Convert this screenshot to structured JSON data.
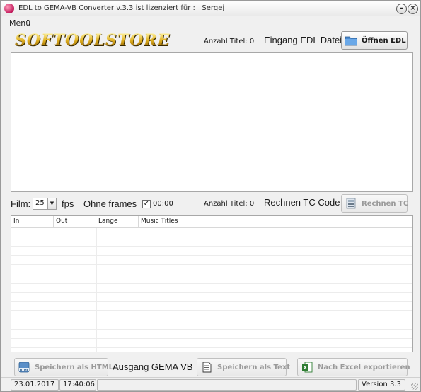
{
  "window": {
    "title": "EDL to GEMA-VB Converter v.3.3 ist lizenziert für :   Sergej",
    "minimize_glyph": "–",
    "close_glyph": "×"
  },
  "menu": {
    "label": "Menü"
  },
  "logo": {
    "text": "SOFTOOLSTORE"
  },
  "top_bar": {
    "count_label": "Anzahl Titel: 0",
    "input_label": "Eingang EDL Datei",
    "open_button": "Öffnen EDL",
    "open_icon": "folder-icon"
  },
  "mid_bar": {
    "film_label": "Film:",
    "fps_value": "25",
    "fps_label": "fps",
    "frames_label": "Ohne frames",
    "checkbox_mark": "✓",
    "checkbox_label": "00:00",
    "count_label": "Anzahl Titel: 0",
    "calc_label": "Rechnen TC Code",
    "calc_button": "Rechnen TC",
    "calc_icon": "calculator-icon"
  },
  "grid": {
    "columns": [
      "In",
      "Out",
      "Länge",
      "Music Titles"
    ]
  },
  "bottom_bar": {
    "html_button": "Speichern als HTML",
    "html_icon": "html-file-icon",
    "output_label": "Ausgang GEMA VB",
    "text_button": "Speichern als Text",
    "text_icon": "text-file-icon",
    "excel_button": "Nach Excel exportieren",
    "excel_icon": "excel-icon"
  },
  "status": {
    "date": "23.01.2017",
    "time": "17:40:06",
    "version": "Version 3.3"
  },
  "colors": {
    "disabled_text": "#9a9a9a",
    "logo_gold": "#e0b020"
  }
}
